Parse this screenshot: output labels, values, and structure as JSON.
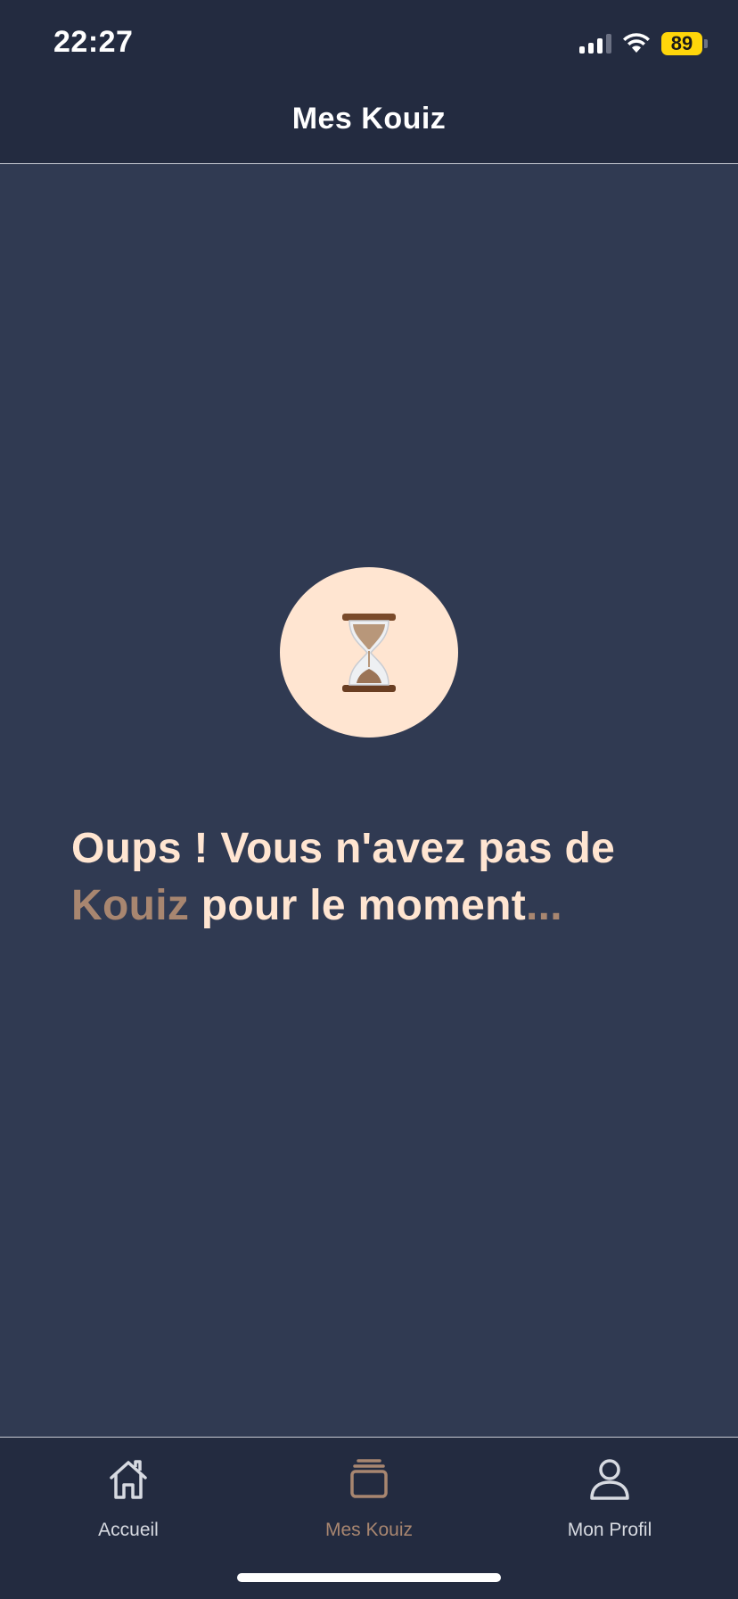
{
  "status_bar": {
    "time": "22:27",
    "battery_level": "89",
    "signal_icon": "cellular-signal-icon",
    "wifi_icon": "wifi-icon"
  },
  "header": {
    "title": "Mes Kouiz"
  },
  "empty_state": {
    "icon": "hourglass-icon",
    "message_part1": "Oups ! Vous n'avez pas de ",
    "message_highlight": "Kouiz",
    "message_part2": " pour le moment",
    "message_ellipsis": "..."
  },
  "tab_bar": {
    "tabs": [
      {
        "label": "Accueil",
        "icon": "home-icon",
        "active": false
      },
      {
        "label": "Mes Kouiz",
        "icon": "stack-icon",
        "active": true
      },
      {
        "label": "Mon Profil",
        "icon": "user-icon",
        "active": false
      }
    ]
  },
  "colors": {
    "background": "#303a52",
    "bar_background": "#232b40",
    "accent": "#a88670",
    "text_light": "#ffe5d1",
    "battery": "#ffd60a"
  }
}
